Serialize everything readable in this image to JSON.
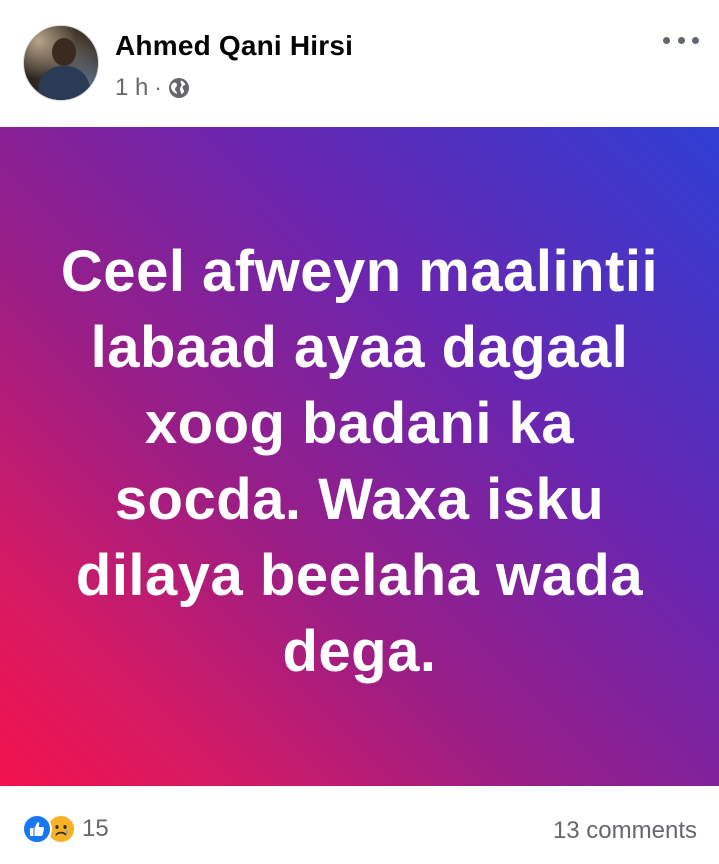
{
  "post": {
    "author": {
      "name": "Ahmed Qani Hirsi",
      "avatar_icon": "profile-photo"
    },
    "meta": {
      "time": "1 h",
      "separator": "·",
      "privacy_icon": "globe-icon"
    },
    "more_icon": "more-options-icon",
    "status": {
      "lines": [
        "Ceel afweyn maalintii",
        "labaad ayaa dagaal",
        "xoog badani ka",
        "socda. Waxa isku",
        "dilaya beelaha wada",
        "dega."
      ],
      "background_colors": [
        "#2f3ed4",
        "#6a26b0",
        "#9a1e86",
        "#d81a62",
        "#f2124d"
      ],
      "text_color": "#ffffff"
    },
    "footer": {
      "reaction_icons": [
        "like-icon",
        "sad-icon"
      ],
      "reaction_count": "15",
      "comments": "13 comments"
    }
  }
}
